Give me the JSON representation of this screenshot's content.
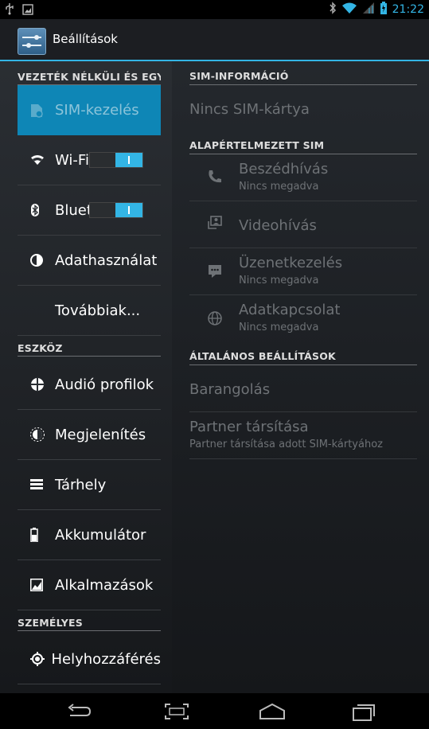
{
  "status_bar": {
    "time": "21:22",
    "icons": [
      "usb-icon",
      "screenshot-icon",
      "bluetooth-icon",
      "wifi-icon",
      "signal-icon",
      "battery-icon"
    ]
  },
  "action_bar": {
    "title": "Beállítások",
    "icon": "settings-sliders-icon"
  },
  "left_pane": {
    "sections": [
      {
        "header": "VEZETÉK NÉLKÜLI ÉS EGYÉB"
      },
      {
        "header": "ESZKÖZ"
      },
      {
        "header": "SZEMÉLYES"
      }
    ],
    "items": [
      {
        "label": "SIM-kezelés",
        "icon": "sim-icon",
        "selected": true
      },
      {
        "label": "Wi-Fi",
        "icon": "wifi-icon",
        "toggle": "on"
      },
      {
        "label": "Bluetooth",
        "icon": "bluetooth-icon",
        "toggle": "on"
      },
      {
        "label": "Adathasználat",
        "icon": "data-usage-icon"
      },
      {
        "label": "Továbbiak...",
        "icon": ""
      },
      {
        "label": "Audió profilok",
        "icon": "audio-profile-icon"
      },
      {
        "label": "Megjelenítés",
        "icon": "display-icon"
      },
      {
        "label": "Tárhely",
        "icon": "storage-icon"
      },
      {
        "label": "Akkumulátor",
        "icon": "battery-icon"
      },
      {
        "label": "Alkalmazások",
        "icon": "apps-icon"
      },
      {
        "label": "Helyhozzáférés",
        "icon": "location-icon"
      }
    ]
  },
  "right_pane": {
    "sim_info_header": "SIM-INFORMÁCIÓ",
    "no_sim": "Nincs SIM-kártya",
    "default_sim_header": "ALAPÉRTELMEZETT SIM",
    "default_items": [
      {
        "title": "Beszédhívás",
        "subtitle": "Nincs megadva",
        "icon": "phone-icon"
      },
      {
        "title": "Videohívás",
        "subtitle": "",
        "icon": "video-call-icon"
      },
      {
        "title": "Üzenetkezelés",
        "subtitle": "Nincs megadva",
        "icon": "message-icon"
      },
      {
        "title": "Adatkapcsolat",
        "subtitle": "Nincs megadva",
        "icon": "globe-icon"
      }
    ],
    "general_header": "ÁLTALÁNOS BEÁLLÍTÁSOK",
    "general_items": [
      {
        "title": "Barangolás",
        "subtitle": ""
      },
      {
        "title": "Partner társítása",
        "subtitle": "Partner társítása adott SIM-kártyához"
      }
    ]
  },
  "nav_bar": {
    "buttons": [
      "back-icon",
      "screenshot-capture-icon",
      "home-icon",
      "recent-apps-icon"
    ]
  }
}
